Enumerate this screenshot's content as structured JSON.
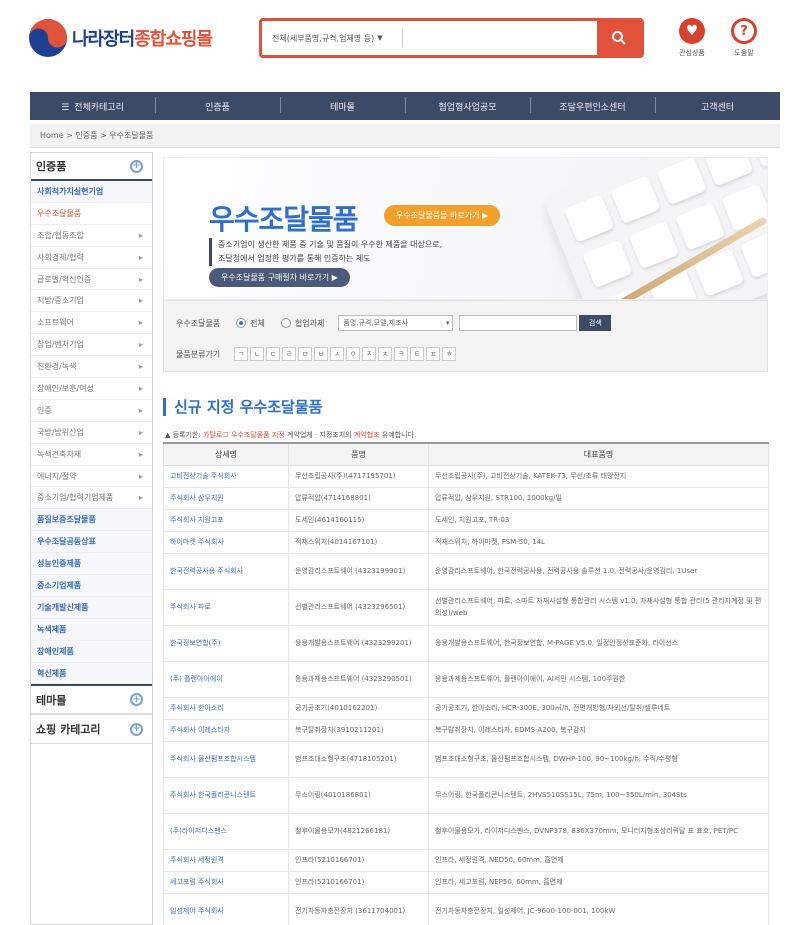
{
  "header": {
    "logo_text_a": "나라장터",
    "logo_text_b": "종합쇼핑몰",
    "search_scope": "전체(세부품명,규격,업체명 등)",
    "search_placeholder": "",
    "icons": [
      {
        "label": "관심상품",
        "glyph": "♥",
        "icon": "heart-icon"
      },
      {
        "label": "도움말",
        "glyph": "?",
        "icon": "help-icon"
      }
    ],
    "accent_color": "#e0523a"
  },
  "nav": {
    "items": [
      "전체카테고리",
      "인증품",
      "테마몰",
      "협업형사업공모",
      "조달우편인소센터",
      "고객센터"
    ]
  },
  "breadcrumb": "Home > 인증품 > 우수조달물품",
  "sidebar": {
    "section_title": "인증품",
    "items": [
      {
        "label": "사회적가치실현기업",
        "hl": true,
        "arrow": false,
        "red": false
      },
      {
        "label": "우수조달물품",
        "hl": false,
        "arrow": false,
        "red": true
      },
      {
        "label": "조합/협동조합",
        "hl": false,
        "arrow": true,
        "red": false
      },
      {
        "label": "사회경제/협력",
        "hl": false,
        "arrow": true,
        "red": false
      },
      {
        "label": "글로벌/혁신인증",
        "hl": false,
        "arrow": true,
        "red": false
      },
      {
        "label": "지방/중소기업",
        "hl": false,
        "arrow": true,
        "red": false
      },
      {
        "label": "소프트웨어",
        "hl": false,
        "arrow": true,
        "red": false
      },
      {
        "label": "창업/벤처기업",
        "hl": false,
        "arrow": true,
        "red": false
      },
      {
        "label": "친환경/녹색",
        "hl": false,
        "arrow": true,
        "red": false
      },
      {
        "label": "장애인/보훈/여성",
        "hl": false,
        "arrow": true,
        "red": false
      },
      {
        "label": "인증",
        "hl": false,
        "arrow": true,
        "red": false
      },
      {
        "label": "국방/방위산업",
        "hl": false,
        "arrow": true,
        "red": false
      },
      {
        "label": "녹색건축자재",
        "hl": false,
        "arrow": true,
        "red": false
      },
      {
        "label": "에너지/절약",
        "hl": false,
        "arrow": true,
        "red": false
      },
      {
        "label": "중소기업/협력기업제품",
        "hl": false,
        "arrow": true,
        "red": false
      },
      {
        "label": "품질보증조달물품",
        "hl": true,
        "arrow": false,
        "red": false
      },
      {
        "label": "우수조달공동상표",
        "hl": true,
        "arrow": false,
        "red": false
      },
      {
        "label": "성능인증제품",
        "hl": true,
        "arrow": false,
        "red": false
      },
      {
        "label": "중소기업제품",
        "hl": true,
        "arrow": false,
        "red": false
      },
      {
        "label": "기술개발신제품",
        "hl": true,
        "arrow": false,
        "red": false
      },
      {
        "label": "녹색제품",
        "hl": true,
        "arrow": false,
        "red": false
      },
      {
        "label": "장애인제품",
        "hl": true,
        "arrow": false,
        "red": false
      },
      {
        "label": "혁신제품",
        "hl": true,
        "arrow": false,
        "red": false
      }
    ],
    "sections": [
      "테마몰",
      "쇼핑 카테고리"
    ]
  },
  "banner": {
    "title": "우수조달물품",
    "pill": "우수조달물품몰 바로가기 ▶",
    "desc_line1": "중소기업이 생산한 제품 중 기술 및 품질이 우수한 제품을 대상으로,",
    "desc_line2": "조달청에서 엄정한 평가를 통해 인증하는 제도",
    "button": "우수조달물품 구매절차 바로가기 ▶"
  },
  "filter": {
    "label1": "우수조달물품",
    "radio1": "전체",
    "radio2": "협업과제",
    "select": "품명,규격,모델,제조사",
    "search_button": "검색",
    "label2": "물품분류가기",
    "consonants": [
      "ㄱ",
      "ㄴ",
      "ㄷ",
      "ㄹ",
      "ㅁ",
      "ㅂ",
      "ㅅ",
      "ㅇ",
      "ㅈ",
      "ㅊ",
      "ㅋ",
      "ㅌ",
      "ㅍ",
      "ㅎ"
    ]
  },
  "section": {
    "title": "신규 지정 우수조달물품",
    "notice_a": "▲ 등록기한:",
    "notice_red": "카탈로그 우수조달물품 지정",
    "notice_b": "계약업체 · 지정조치의",
    "notice_red2": "계약협조",
    "notice_c": "유예합니다."
  },
  "table": {
    "headers": [
      "상세명",
      "품명",
      "대표품명"
    ],
    "rows": [
      {
        "name": "고비전상기술 주식회사",
        "item": "무선조립공사(주)(4717195701)",
        "spec": "무선조립공사(주), 고비전상기술, KATEK-73, 무선/조류 태양전지",
        "tall": false
      },
      {
        "name": "주식회사 삼우지원",
        "item": "압류적압(4714168801)",
        "spec": "압류적압, 삼우지원, STR100, 1000kg/일",
        "tall": false
      },
      {
        "name": "주식회사 지원고포",
        "item": "도세인(4614160115)",
        "spec": "도세인, 지원고포, TR-03",
        "tall": false
      },
      {
        "name": "하이마켓 주식회사",
        "item": "적재스위치(4014167101)",
        "spec": "적재스위치, 하이마켓, FSM-50, 14L",
        "tall": false
      },
      {
        "name": "한국전력공사용 주식회사",
        "item": "운영감리스프트웨어 (4323199901)",
        "spec": "운영감리스프트웨어, 한국전력공사용, 전력공사용 솔루션 1.0, 전력공사/운영감리, 1User",
        "tall": true
      },
      {
        "name": "주식회사 파로",
        "item": "선별관리스프트웨어 (4323296501)",
        "spec": "선별관리스프트웨어, 파로, 스마트 자재사설형 통합관리 시스템 v1.0, 자재사설형 통합 관리(5 관리자계정 및 편의성)/web",
        "tall": true
      },
      {
        "name": "한국정보연합(주)",
        "item": "응용개발용스프트웨어 (4323299201)",
        "spec": "응용개발용스프트웨어, 한국정보연합, M-PAGE V5.0, 일정안정성표준화, 라이선스",
        "tall": true
      },
      {
        "name": "(주) 플랜아이에이",
        "item": "응용과제용스프트웨어 (4323290501)",
        "spec": "응용과제용스프트웨어, 플랜아이에이, AI서민 시스템, 100주권한",
        "tall": true
      },
      {
        "name": "주식회사 한아소리",
        "item": "공기공조기(4010162201)",
        "spec": "공기공조기, 한아소리, HCR-300E, 300㎥/h, 전면개방형/자외선/탈취/셀루네트",
        "tall": false
      },
      {
        "name": "주식회사 이레스타자",
        "item": "복구탈취장치(3910211201)",
        "spec": "복구탈취장치, 이레스타자, EDMS-A200, 복구감지",
        "tall": false
      },
      {
        "name": "주식회사 물산펌프조합시스템",
        "item": "범프조대소형구조(4718105201)",
        "spec": "범프조대소형구조, 물산펌프조합시스템, DWHP-100, 90~100kg/h, 수직/수평형",
        "tall": true
      },
      {
        "name": "주식회사 한국폴리콘니스텐트",
        "item": "무스이링(4010186801)",
        "spec": "무스이링, 한국폴리콘니스텐트, 2HVS510SS15L, 75m, 100~350L/min, 304Sts",
        "tall": true
      },
      {
        "name": "(주)라이저디스펜스",
        "item": "철후이물용모가(4821266181)",
        "spec": "철후이물용모가, 라이저디스펜스, DVNP378, 836X370mm, 모니터지형조상리퀴달 표 표호, PET/PC",
        "tall": true
      },
      {
        "name": "주식회사 세정원격",
        "item": "인프라(5210166701)",
        "spec": "인프라, 세정원격, NED50, 60mm, 흡연제",
        "tall": false
      },
      {
        "name": "세고포럼 주식회사",
        "item": "인프라(5210166701)",
        "spec": "인프라, 세고포럼, NEP50, 60mm, 흡연제",
        "tall": false
      },
      {
        "name": "일성제어 주식회사",
        "item": "전기자동차충전장치 (3611704001)",
        "spec": "전기자동차충전장치, 일성제어, JC-9600-100-001, 100kW",
        "tall": true
      }
    ]
  }
}
